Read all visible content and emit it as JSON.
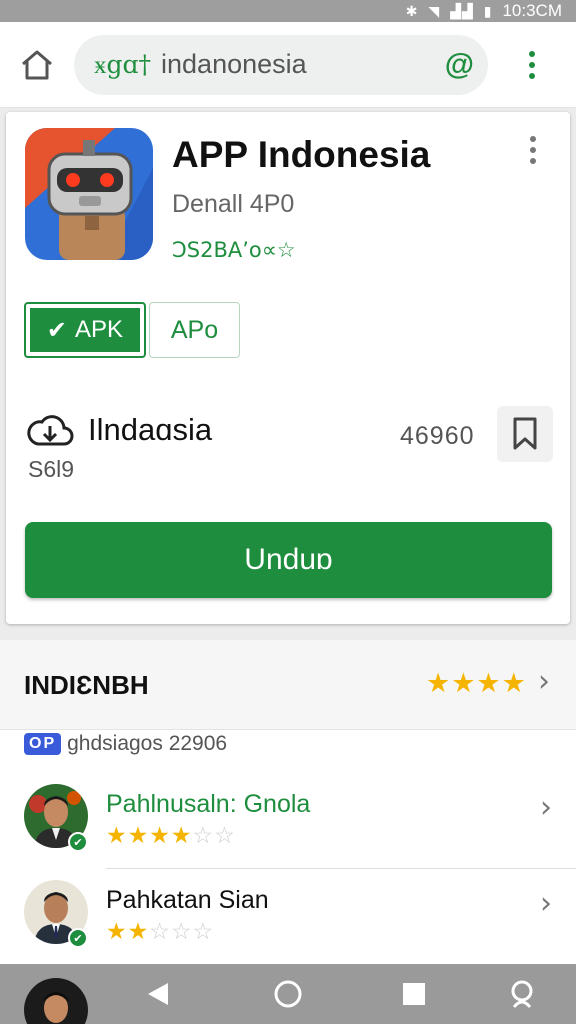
{
  "status_bar": {
    "time": "10:3CM",
    "icons": [
      "bluetooth-icon",
      "wifi-icon",
      "signal-icon",
      "battery-icon"
    ]
  },
  "browser": {
    "url_prefix": "ӿgɑ†",
    "url_text": "indanonesia",
    "url_action_icon": "at-icon",
    "menu_icon": "more-vert-icon"
  },
  "app": {
    "title": "APP Indonesia",
    "subtitle": "Denall 4P0",
    "rating_text": "ↃS2BA’o∝☆",
    "badges": {
      "apk": "APK",
      "apo": "APo"
    },
    "download": {
      "label": "Ilndaɑsia",
      "size": "S6l9",
      "count": "46960"
    },
    "primary_button": "Unduɒ"
  },
  "reviews": {
    "header": "INDIƐNBH",
    "header_stars": "★★★★",
    "op_badge": "OP",
    "op_text": "ɡhdsiagos 22906",
    "items": [
      {
        "name": "Pahlnusaln: Gnola",
        "name_color": "#1e8e3e",
        "rating": 4.5,
        "stars_on": "★★★★",
        "stars_off": "☆☆"
      },
      {
        "name": "Pahkatan Sian",
        "name_color": "#111111",
        "rating": 2.5,
        "stars_on": "★★",
        "stars_off": "☆☆☆"
      }
    ]
  },
  "colors": {
    "accent": "#1e8e3e",
    "star": "#f4b400",
    "op_badge": "#3a5bd9"
  }
}
